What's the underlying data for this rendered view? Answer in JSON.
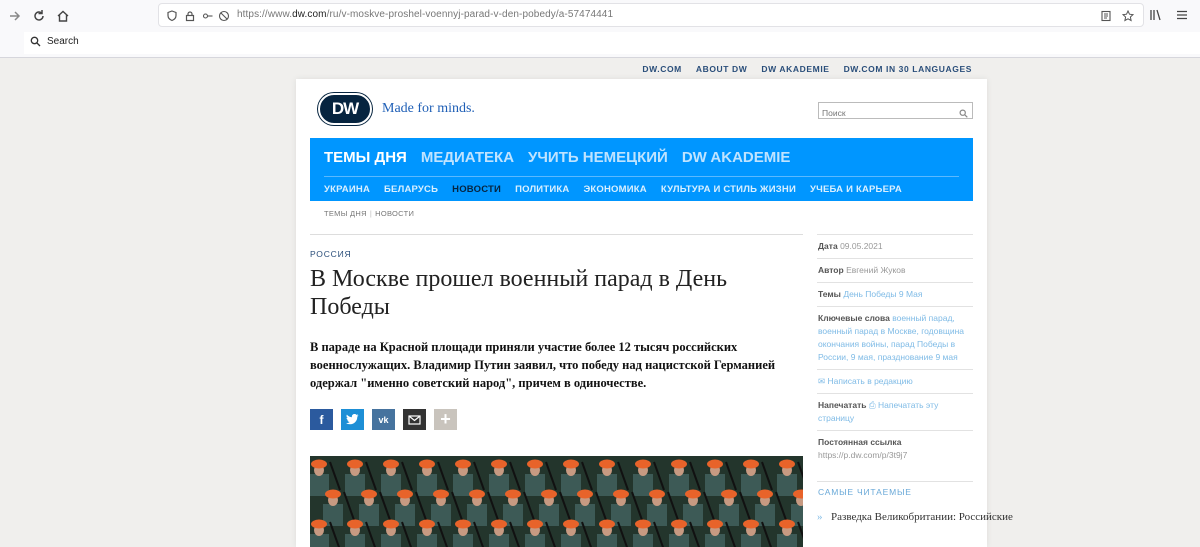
{
  "browser": {
    "url_prefix": "https://www.",
    "url_domain": "dw.com",
    "url_path": "/ru/v-moskve-proshel-voennyj-parad-v-den-pobedy/a-57474441",
    "bookmark_search_label": "Search"
  },
  "toplinks": [
    "DW.COM",
    "ABOUT DW",
    "DW AKADEMIE",
    "DW.COM IN 30 LANGUAGES"
  ],
  "header": {
    "logo_text": "DW",
    "tagline": "Made for minds.",
    "search_placeholder": "Поиск"
  },
  "main_tabs": [
    "ТЕМЫ ДНЯ",
    "МЕДИАТЕКА",
    "УЧИТЬ НЕМЕЦКИЙ",
    "DW AKADEMIE"
  ],
  "sub_tabs": [
    "УКРАИНА",
    "БЕЛАРУСЬ",
    "НОВОСТИ",
    "ПОЛИТИКА",
    "ЭКОНОМИКА",
    "КУЛЬТУРА И СТИЛЬ ЖИЗНИ",
    "УЧЕБА И КАРЬЕРА"
  ],
  "breadcrumb": [
    "ТЕМЫ ДНЯ",
    "НОВОСТИ"
  ],
  "article": {
    "category": "РОССИЯ",
    "title": "В Москве прошел военный парад в День Победы",
    "lead": "В параде на Красной площади приняли участие более 12 тысяч российских военнослужащих. Владимир Путин заявил, что победу над нацистской Германией одержал \"именно советский народ\", причем в одиночестве."
  },
  "sidebar": {
    "date_label": "Дата",
    "date_value": "09.05.2021",
    "author_label": "Автор",
    "author_value": "Евгений Жуков",
    "topics_label": "Темы",
    "topics_value": "День Победы 9 Мая",
    "keywords_label": "Ключевые слова",
    "keywords_value": "военный парад, военный парад в Москве, годовщина окончания войны, парад Победы в России, 9 мая, празднование 9 мая",
    "write_label": "Написать в редакцию",
    "print_label": "Напечатать",
    "print_value": "Напечатать эту страницу",
    "permalink_label": "Постоянная ссылка",
    "permalink_value": "https://p.dw.com/p/3t9j7",
    "popular_title": "САМЫЕ ЧИТАЕМЫЕ",
    "popular_items": [
      "Разведка Великобритании: Российские"
    ]
  }
}
